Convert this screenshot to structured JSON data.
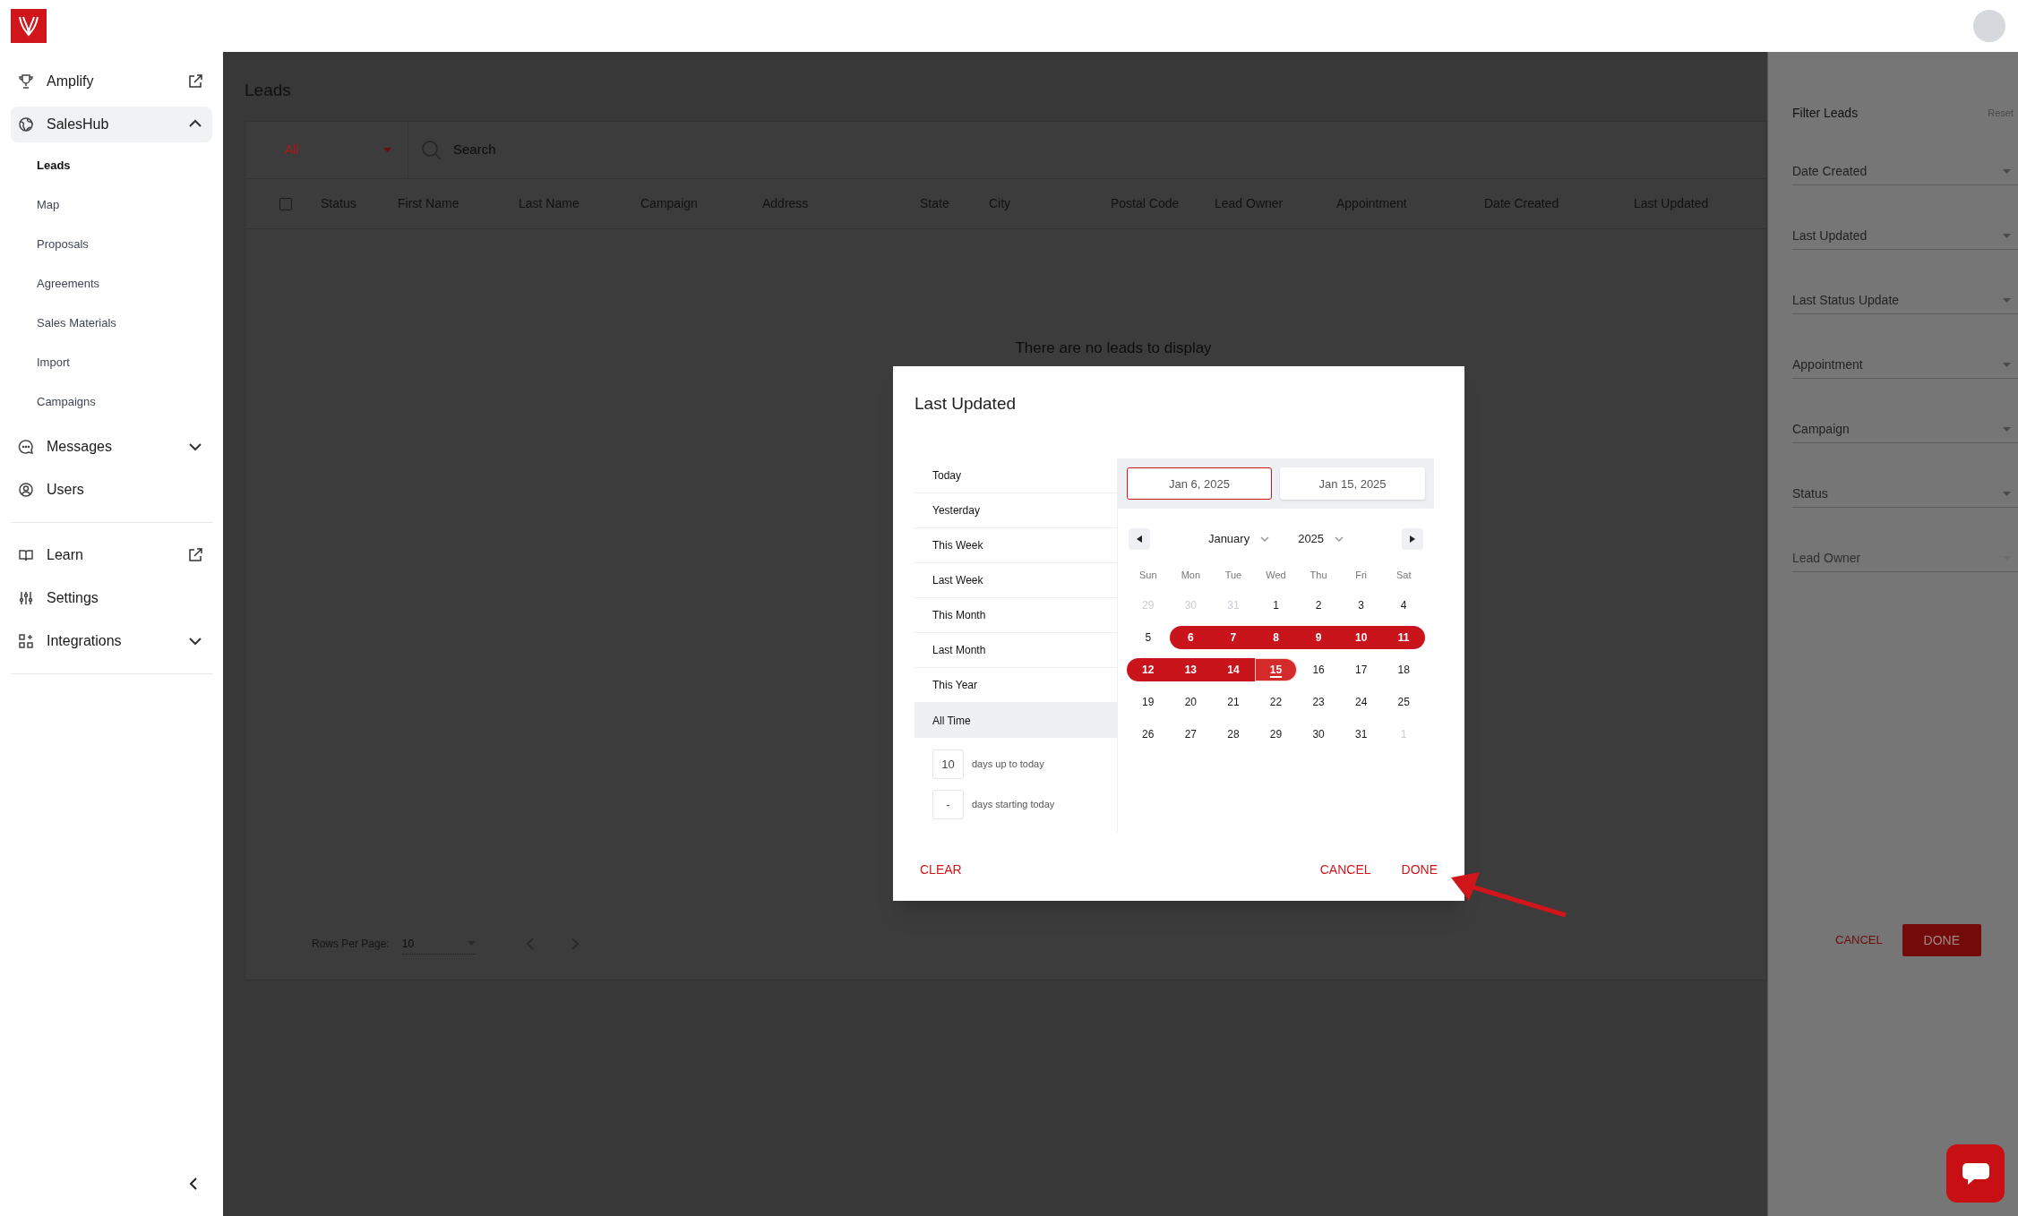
{
  "sidebar": {
    "sections": [
      [
        {
          "label": "Amplify",
          "kind": "external"
        },
        {
          "label": "SalesHub",
          "kind": "group",
          "expanded": true,
          "selected": true,
          "children": [
            {
              "label": "Leads",
              "selected": true
            },
            {
              "label": "Map",
              "selected": false
            },
            {
              "label": "Proposals",
              "selected": false
            },
            {
              "label": "Agreements",
              "selected": false
            },
            {
              "label": "Sales Materials",
              "selected": false
            },
            {
              "label": "Import",
              "selected": false
            },
            {
              "label": "Campaigns",
              "selected": false
            }
          ]
        },
        {
          "label": "Messages",
          "kind": "group",
          "expanded": false,
          "selected": false
        },
        {
          "label": "Users",
          "kind": "link"
        }
      ],
      [
        {
          "label": "Learn",
          "kind": "external"
        },
        {
          "label": "Settings",
          "kind": "link"
        },
        {
          "label": "Integrations",
          "kind": "group",
          "expanded": false,
          "selected": false
        }
      ]
    ]
  },
  "page_title": "Leads",
  "toolbar": {
    "filter": "All",
    "search_placeholder": "Search"
  },
  "table": {
    "header_checked": false,
    "columns": [
      "Status",
      "First Name",
      "Last Name",
      "Campaign",
      "Address",
      "State",
      "City",
      "Postal Code",
      "Lead Owner",
      "Appointment",
      "Date Created",
      "Last Updated"
    ],
    "empty_message": "There are no leads to display"
  },
  "pagination": {
    "label": "Rows Per Page:",
    "rows_per_page": "10"
  },
  "dialog": {
    "title": "Last Updated",
    "presets": [
      {
        "label": "Today",
        "selected": false
      },
      {
        "label": "Yesterday",
        "selected": false
      },
      {
        "label": "This Week",
        "selected": false
      },
      {
        "label": "Last Week",
        "selected": false
      },
      {
        "label": "This Month",
        "selected": false
      },
      {
        "label": "Last Month",
        "selected": false
      },
      {
        "label": "This Year",
        "selected": false
      },
      {
        "label": "All Time",
        "selected": true
      }
    ],
    "relative": [
      {
        "value": "10",
        "label": "days up to today"
      },
      {
        "value": "-",
        "label": "days starting today"
      }
    ],
    "date_fields": [
      {
        "value": "Jan 6, 2025",
        "selected": true
      },
      {
        "value": "Jan 15, 2025",
        "selected": false
      }
    ],
    "month": "January",
    "year": "2025",
    "weekdays": [
      "Sun",
      "Mon",
      "Tue",
      "Wed",
      "Thu",
      "Fri",
      "Sat"
    ],
    "weeks": [
      [
        {
          "d": "29",
          "outside": true,
          "in_range": false,
          "today": false
        },
        {
          "d": "30",
          "outside": true,
          "in_range": false,
          "today": false
        },
        {
          "d": "31",
          "outside": true,
          "in_range": false,
          "today": false
        },
        {
          "d": "1",
          "outside": false,
          "in_range": false,
          "today": false
        },
        {
          "d": "2",
          "outside": false,
          "in_range": false,
          "today": false
        },
        {
          "d": "3",
          "outside": false,
          "in_range": false,
          "today": false
        },
        {
          "d": "4",
          "outside": false,
          "in_range": false,
          "today": false
        }
      ],
      [
        {
          "d": "5",
          "outside": false,
          "in_range": false,
          "today": false
        },
        {
          "d": "6",
          "outside": false,
          "in_range": true,
          "today": false
        },
        {
          "d": "7",
          "outside": false,
          "in_range": true,
          "today": false
        },
        {
          "d": "8",
          "outside": false,
          "in_range": true,
          "today": false
        },
        {
          "d": "9",
          "outside": false,
          "in_range": true,
          "today": false
        },
        {
          "d": "10",
          "outside": false,
          "in_range": true,
          "today": false
        },
        {
          "d": "11",
          "outside": false,
          "in_range": true,
          "today": false
        }
      ],
      [
        {
          "d": "12",
          "outside": false,
          "in_range": true,
          "today": false
        },
        {
          "d": "13",
          "outside": false,
          "in_range": true,
          "today": false
        },
        {
          "d": "14",
          "outside": false,
          "in_range": true,
          "today": false
        },
        {
          "d": "15",
          "outside": false,
          "in_range": true,
          "today": true
        },
        {
          "d": "16",
          "outside": false,
          "in_range": false,
          "today": false
        },
        {
          "d": "17",
          "outside": false,
          "in_range": false,
          "today": false
        },
        {
          "d": "18",
          "outside": false,
          "in_range": false,
          "today": false
        }
      ],
      [
        {
          "d": "19",
          "outside": false,
          "in_range": false,
          "today": false
        },
        {
          "d": "20",
          "outside": false,
          "in_range": false,
          "today": false
        },
        {
          "d": "21",
          "outside": false,
          "in_range": false,
          "today": false
        },
        {
          "d": "22",
          "outside": false,
          "in_range": false,
          "today": false
        },
        {
          "d": "23",
          "outside": false,
          "in_range": false,
          "today": false
        },
        {
          "d": "24",
          "outside": false,
          "in_range": false,
          "today": false
        },
        {
          "d": "25",
          "outside": false,
          "in_range": false,
          "today": false
        }
      ],
      [
        {
          "d": "26",
          "outside": false,
          "in_range": false,
          "today": false
        },
        {
          "d": "27",
          "outside": false,
          "in_range": false,
          "today": false
        },
        {
          "d": "28",
          "outside": false,
          "in_range": false,
          "today": false
        },
        {
          "d": "29",
          "outside": false,
          "in_range": false,
          "today": false
        },
        {
          "d": "30",
          "outside": false,
          "in_range": false,
          "today": false
        },
        {
          "d": "31",
          "outside": false,
          "in_range": false,
          "today": false
        },
        {
          "d": "1",
          "outside": true,
          "in_range": false,
          "today": false
        }
      ]
    ],
    "clear": "CLEAR",
    "cancel": "CANCEL",
    "done": "DONE"
  },
  "filter_panel": {
    "title": "Filter Leads",
    "reset": "Reset",
    "fields": [
      {
        "placeholder": "Date Created",
        "disabled": false
      },
      {
        "placeholder": "Last Updated",
        "disabled": false
      },
      {
        "placeholder": "Last Status Update",
        "disabled": false
      },
      {
        "placeholder": "Appointment",
        "disabled": false
      },
      {
        "placeholder": "Campaign",
        "disabled": false
      },
      {
        "placeholder": "Status",
        "disabled": false
      },
      {
        "placeholder": "Lead Owner",
        "disabled": true
      }
    ],
    "cancel": "CANCEL",
    "done": "DONE"
  }
}
